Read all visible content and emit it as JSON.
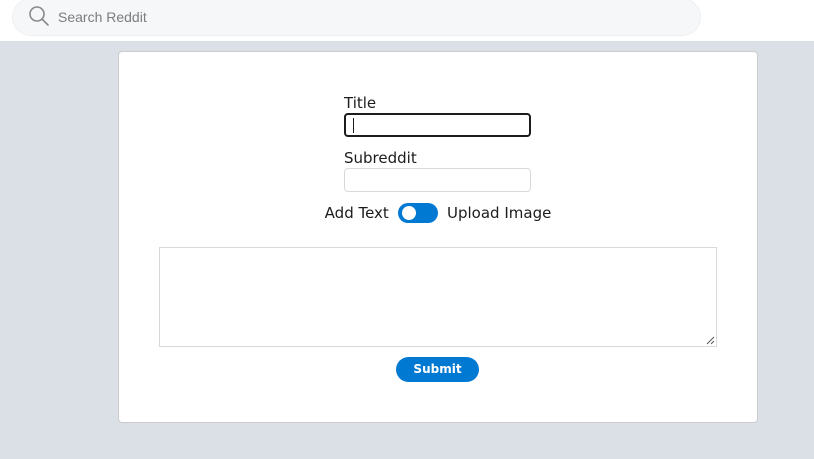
{
  "header": {
    "search": {
      "placeholder": "Search Reddit",
      "value": "",
      "icon": "search-icon"
    }
  },
  "form": {
    "title_label": "Title",
    "title_value": "",
    "subreddit_label": "Subreddit",
    "subreddit_value": "",
    "toggle": {
      "left_label": "Add Text",
      "right_label": "Upload Image",
      "color": "#0079d3"
    },
    "body_value": "",
    "submit_label": "Submit"
  },
  "colors": {
    "accent": "#0079d3",
    "page_background": "#dae0e6",
    "card_background": "#ffffff"
  }
}
